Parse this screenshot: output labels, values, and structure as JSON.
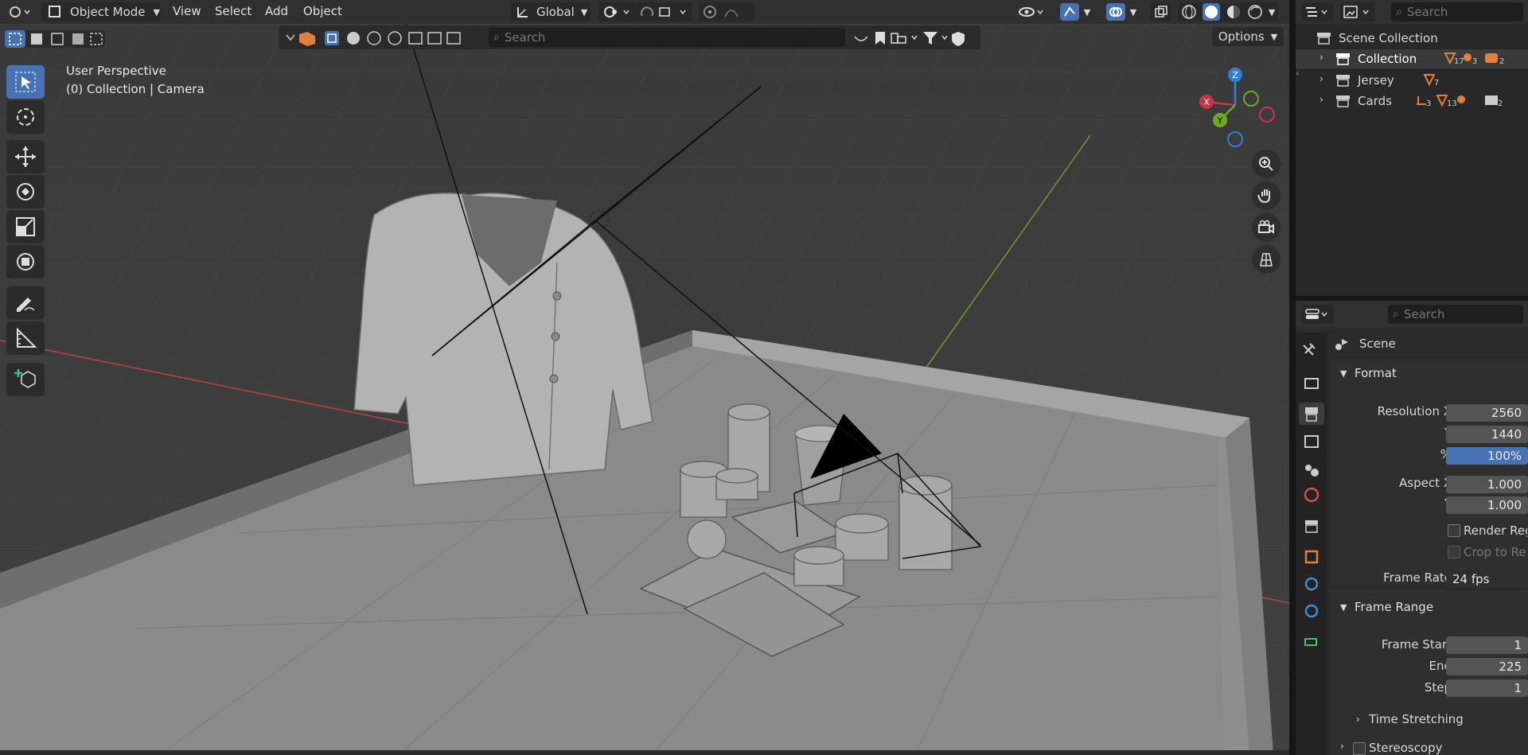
{
  "header": {
    "mode_label": "Object Mode",
    "menus": [
      "View",
      "Select",
      "Add",
      "Object"
    ],
    "transform_orientation": "Global",
    "options_label": "Options"
  },
  "viewport": {
    "search_placeholder": "Search",
    "overlay_title": "User Perspective",
    "overlay_context": "(0) Collection | Camera",
    "gizmo_axes": {
      "x": "X",
      "y": "Y",
      "z": "Z"
    },
    "colors": {
      "x_axis": "#c8334b",
      "y_axis": "#6eaa1f",
      "z_axis": "#2d7fd8",
      "selected": "#4772b3"
    }
  },
  "outliner": {
    "search_placeholder": "Search",
    "root": "Scene Collection",
    "items": [
      {
        "label": "Collection",
        "counts": [
          "17",
          "3",
          "2"
        ]
      },
      {
        "label": "Jersey",
        "counts": [
          "7"
        ]
      },
      {
        "label": "Cards",
        "counts": [
          "3",
          "13",
          "2"
        ]
      }
    ]
  },
  "properties": {
    "search_placeholder": "Search",
    "context": "Scene",
    "format": {
      "title": "Format",
      "resolution_x_label": "Resolution X",
      "resolution_x": "2560",
      "y_label": "Y",
      "resolution_y": "1440",
      "pct_label": "%",
      "resolution_pct": "100%",
      "aspect_x_label": "Aspect X",
      "aspect_x": "1.000",
      "aspect_y_label": "Y",
      "aspect_y": "1.000",
      "render_region": "Render Region",
      "crop_region": "Crop to Render Region",
      "frame_rate_label": "Frame Rate",
      "frame_rate": "24 fps"
    },
    "frame_range": {
      "title": "Frame Range",
      "start_label": "Frame Start",
      "start": "1",
      "end_label": "End",
      "end": "225",
      "step_label": "Step",
      "step": "1"
    },
    "time_stretching": "Time Stretching",
    "stereoscopy": "Stereoscopy"
  }
}
